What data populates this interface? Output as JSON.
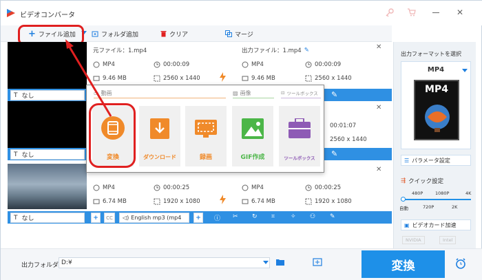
{
  "app": {
    "title": "ビデオコンバータ"
  },
  "toolbar": {
    "add_file": "ファイル追加",
    "add_folder": "フォルダ追加",
    "clear": "クリア",
    "merge": "マージ"
  },
  "files": [
    {
      "source_label": "元ファイル：1.mp4",
      "output_label": "出力ファイル：1.mp4",
      "src_format": "MP4",
      "src_duration": "00:00:09",
      "src_size": "9.46 MB",
      "src_res": "2560 x 1440",
      "out_format": "MP4",
      "out_duration": "00:00:09",
      "out_size": "9.46 MB",
      "out_res": "2560 x 1440",
      "subtitle": "なし"
    },
    {
      "out_duration": "00:01:07",
      "out_res": "2560 x 1440",
      "subtitle": "なし"
    },
    {
      "src_format": "MP4",
      "src_duration": "00:00:25",
      "src_size": "6.74 MB",
      "src_res": "1920 x 1080",
      "out_format": "MP4",
      "out_duration": "00:00:25",
      "out_size": "6.74 MB",
      "out_res": "1920 x 1080",
      "subtitle": "なし",
      "audio_track": "English mp3 (mp4"
    }
  ],
  "popup": {
    "cat_video": "動画",
    "cat_image": "画像",
    "cat_toolbox": "ツールボックス",
    "tiles": [
      {
        "label": "変換",
        "color": "#f08a2a"
      },
      {
        "label": "ダウンロード",
        "color": "#f08a2a"
      },
      {
        "label": "録画",
        "color": "#f08a2a"
      },
      {
        "label": "GIF作成",
        "color": "#4cb648"
      },
      {
        "label": "ツールボックス",
        "color": "#8e5bb5"
      }
    ]
  },
  "right_panel": {
    "select_format": "出力フォーマットを選択",
    "format_name": "MP4",
    "format_icon": "MP4",
    "params": "パラメータ設定",
    "quick": "クイック設定",
    "quality_top": [
      "480P",
      "1080P",
      "4K"
    ],
    "quality_bottom": [
      "自動",
      "720P",
      "2K"
    ],
    "gpu": "ビデオカード加速",
    "nvidia": "NVIDIA",
    "intel": "Intel"
  },
  "bottom": {
    "output_label": "出力フォルダ：",
    "output_path": "D:¥",
    "convert": "変換"
  },
  "colors": {
    "accent": "#1e90e8",
    "red": "#e02020",
    "blue_bar": "#2f90e3"
  }
}
